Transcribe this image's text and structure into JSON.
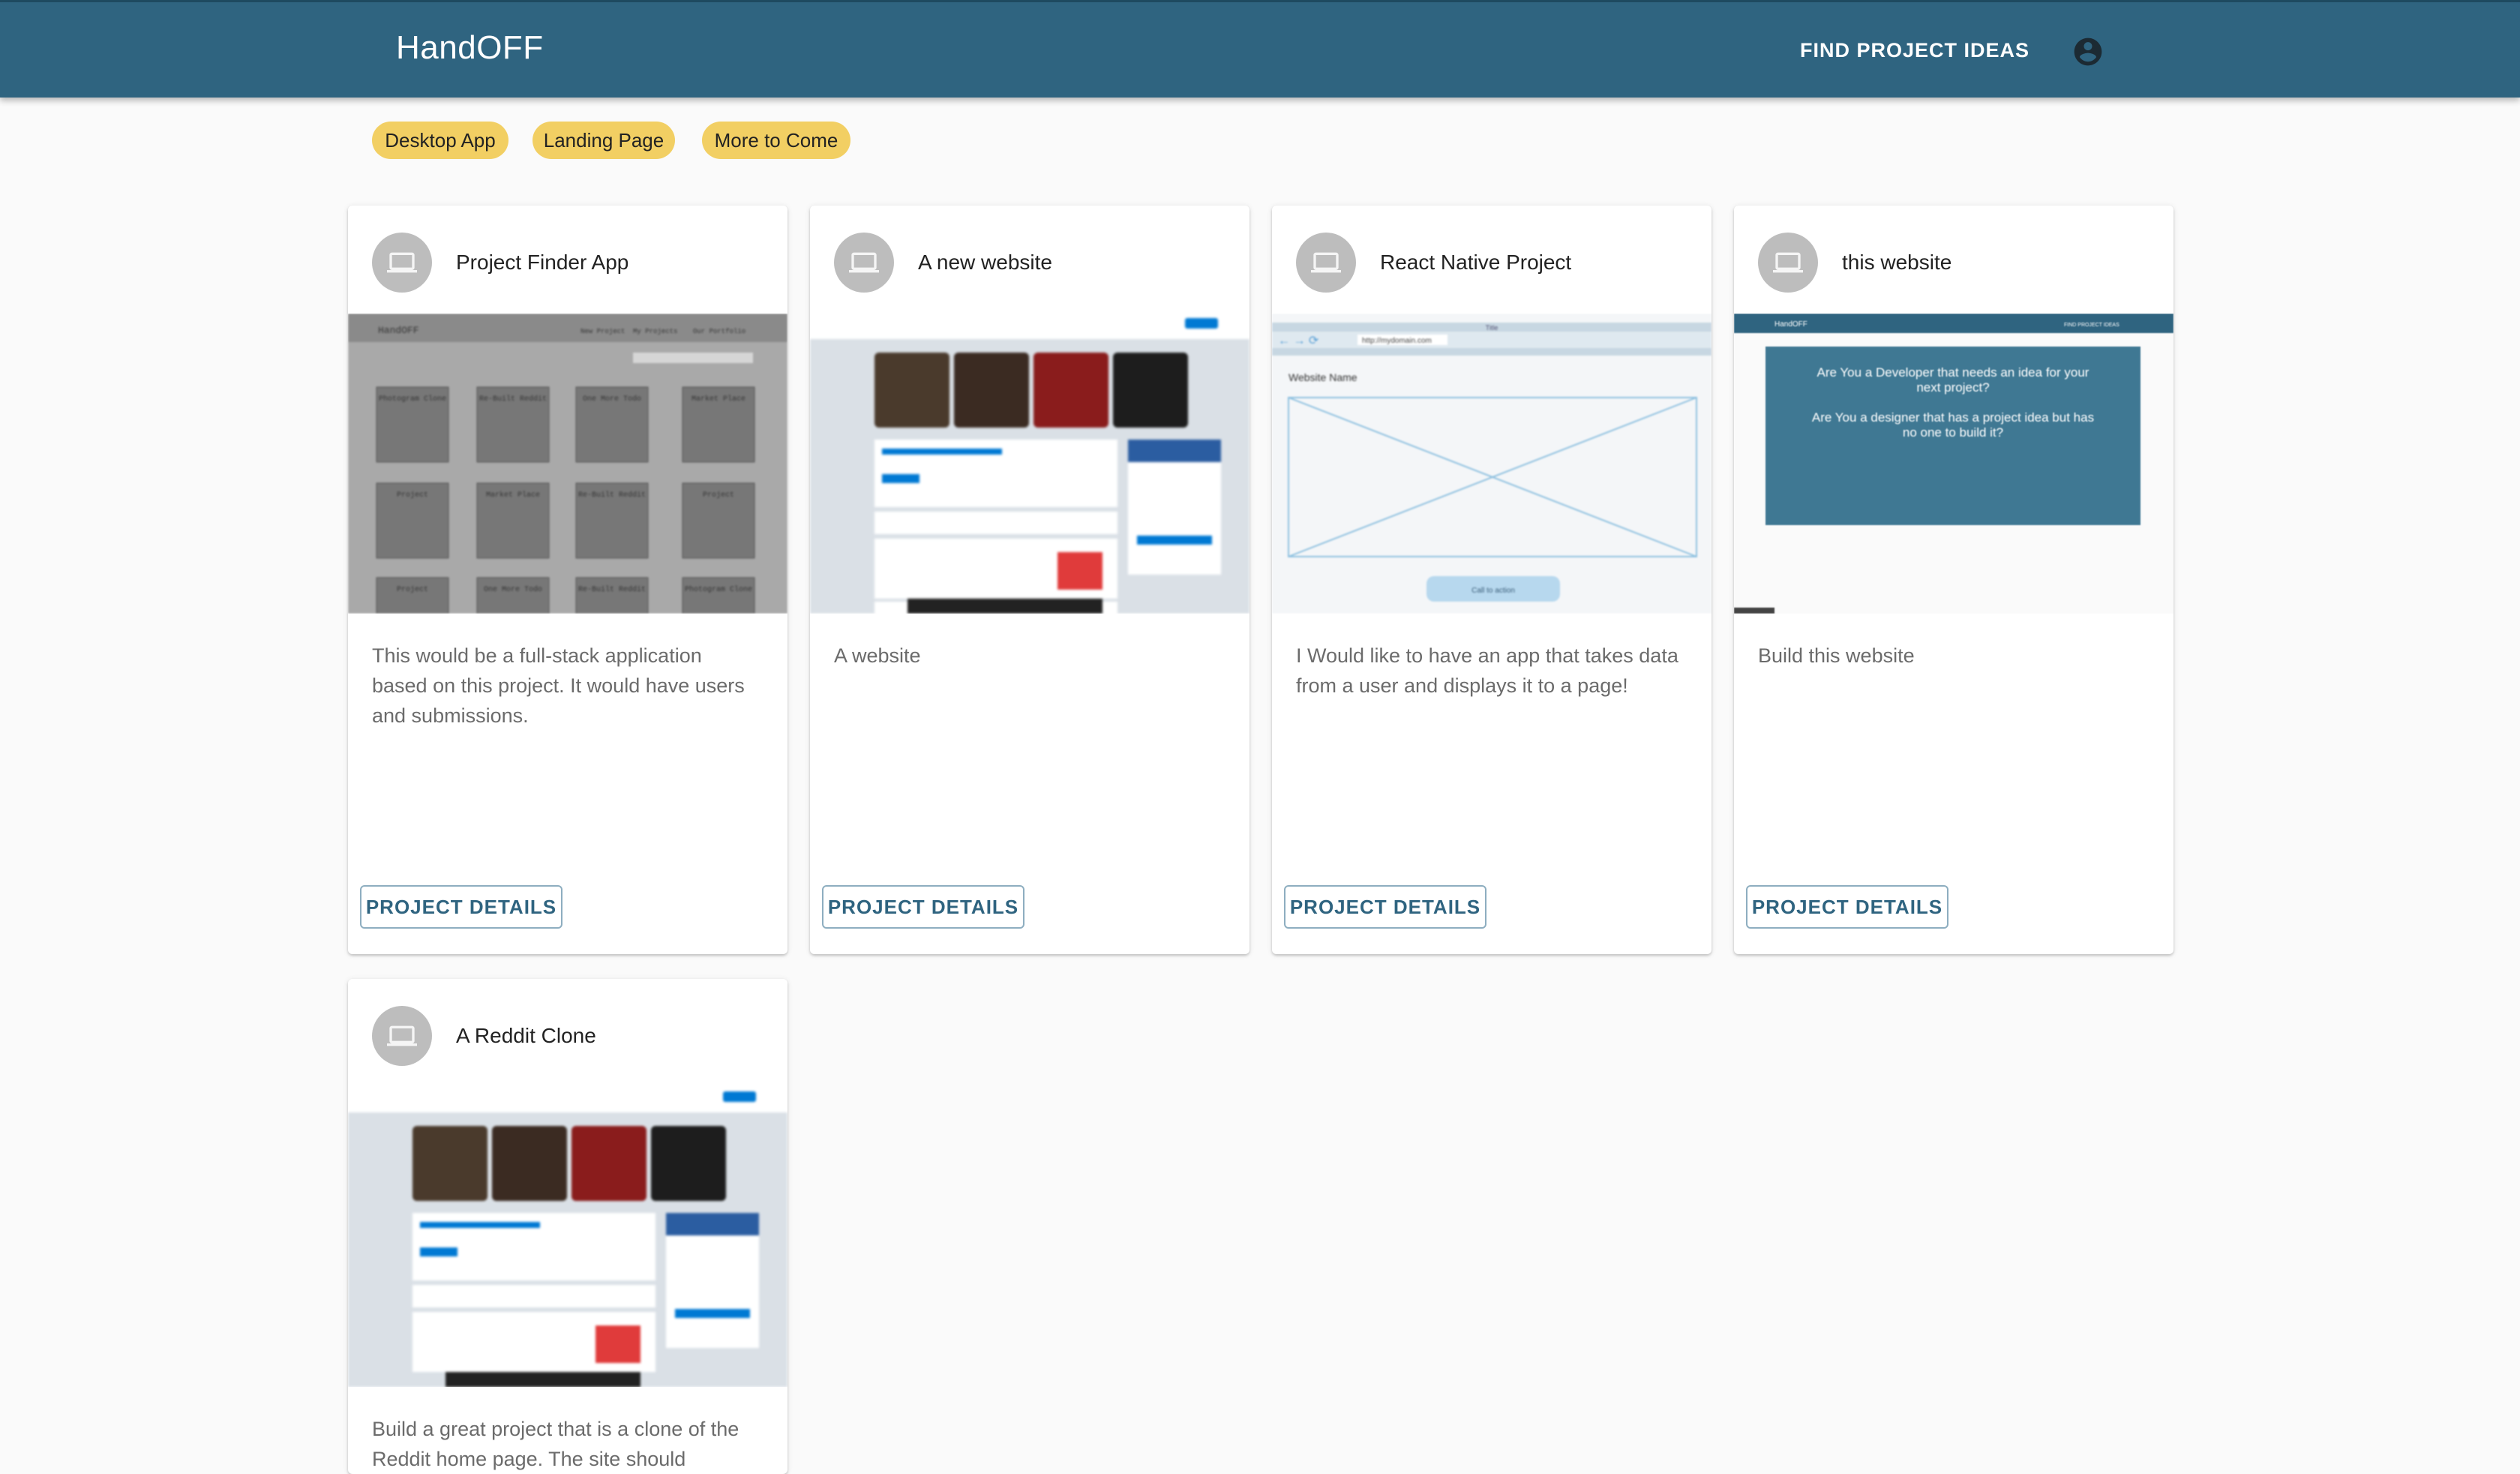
{
  "app": {
    "brand": "HandOFF"
  },
  "nav": {
    "find_ideas": "FIND PROJECT IDEAS",
    "account_icon": "account-circle-icon"
  },
  "filters": [
    {
      "label": "Desktop App"
    },
    {
      "label": "Landing Page"
    },
    {
      "label": "More to Come"
    }
  ],
  "cards": [
    {
      "title": "Project Finder App",
      "description": "This would be a full-stack application based on this project. It would have users and submissions.",
      "button": "PROJECT DETAILS",
      "icon": "laptop-icon",
      "media": {
        "brand": "HandOFF",
        "nav": [
          "New Project",
          "My Projects",
          "Our Portfolio"
        ],
        "tiles": [
          "Photogram Clone",
          "Re-Built Reddit",
          "One More Todo",
          "Market Place",
          "Project",
          "Market Place",
          "Re-Built Reddit",
          "Project",
          "Project",
          "One More Todo",
          "Re-Built Reddit",
          "Photogram Clone"
        ]
      }
    },
    {
      "title": "A new website",
      "description": "A website",
      "button": "PROJECT DETAILS",
      "icon": "laptop-icon"
    },
    {
      "title": "React Native Project",
      "description": "I Would like to have an app that takes data from a user and displays it to a page!",
      "button": "PROJECT DETAILS",
      "icon": "laptop-icon",
      "media": {
        "window_title": "Title",
        "url": "http://mydomain.com",
        "site_name": "Website Name",
        "cta": "Call to action"
      }
    },
    {
      "title": "this website",
      "description": "Build this website",
      "button": "PROJECT DETAILS",
      "icon": "laptop-icon",
      "media": {
        "brand": "HandOFF",
        "nav": "FIND PROJECT IDEAS",
        "line1": "Are You a Developer that needs an idea for your next project?",
        "line2": "Are You a designer that has a project idea but has no one to build it?"
      }
    },
    {
      "title": "A Reddit Clone",
      "description": "Build a great project that is a clone of the Reddit home page. The site should",
      "button": "PROJECT DETAILS",
      "icon": "laptop-icon"
    }
  ],
  "colors": {
    "appbar": "#2f6480",
    "chip": "#f2cf63",
    "button_text": "#2f6480"
  }
}
